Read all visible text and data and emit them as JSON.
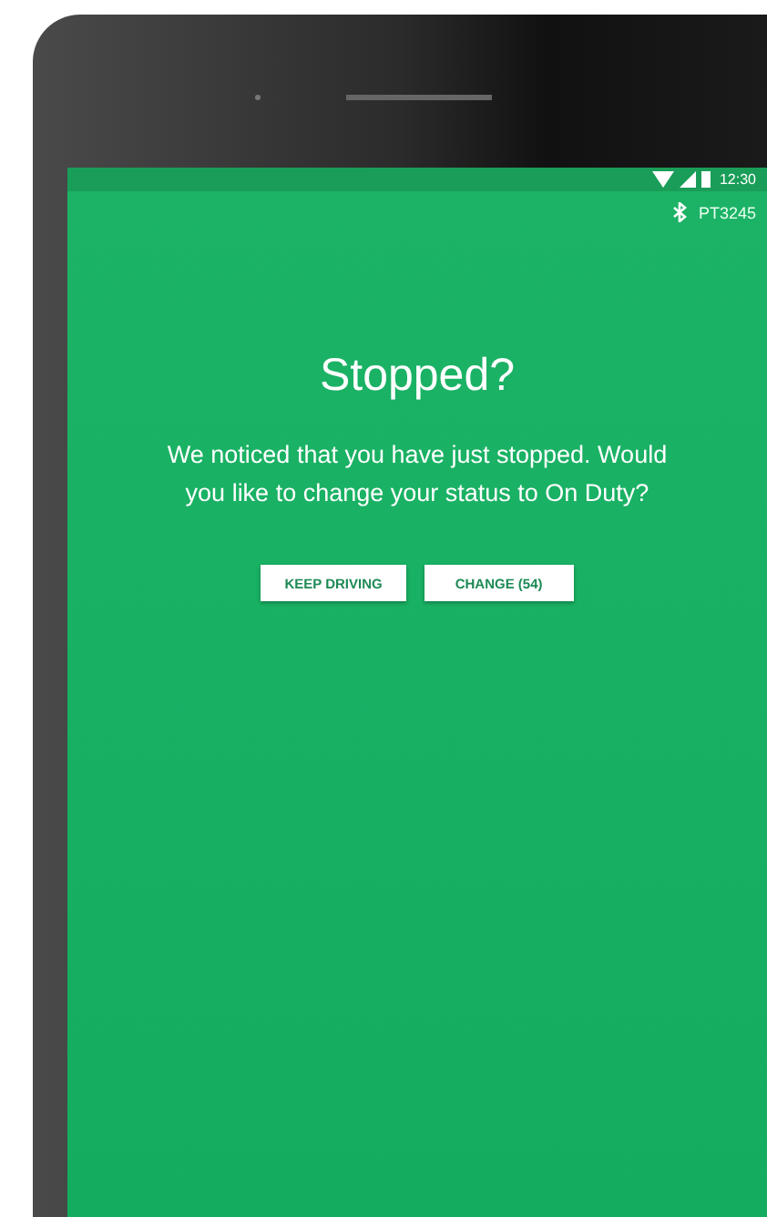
{
  "status_bar": {
    "time": "12:30"
  },
  "header": {
    "device_id": "PT3245"
  },
  "dialog": {
    "title": "Stopped?",
    "message": "We noticed that you have just stopped. Would you like to change your status to On Duty?"
  },
  "buttons": [
    {
      "label": "KEEP DRIVING"
    },
    {
      "label": "CHANGE (54)"
    }
  ]
}
